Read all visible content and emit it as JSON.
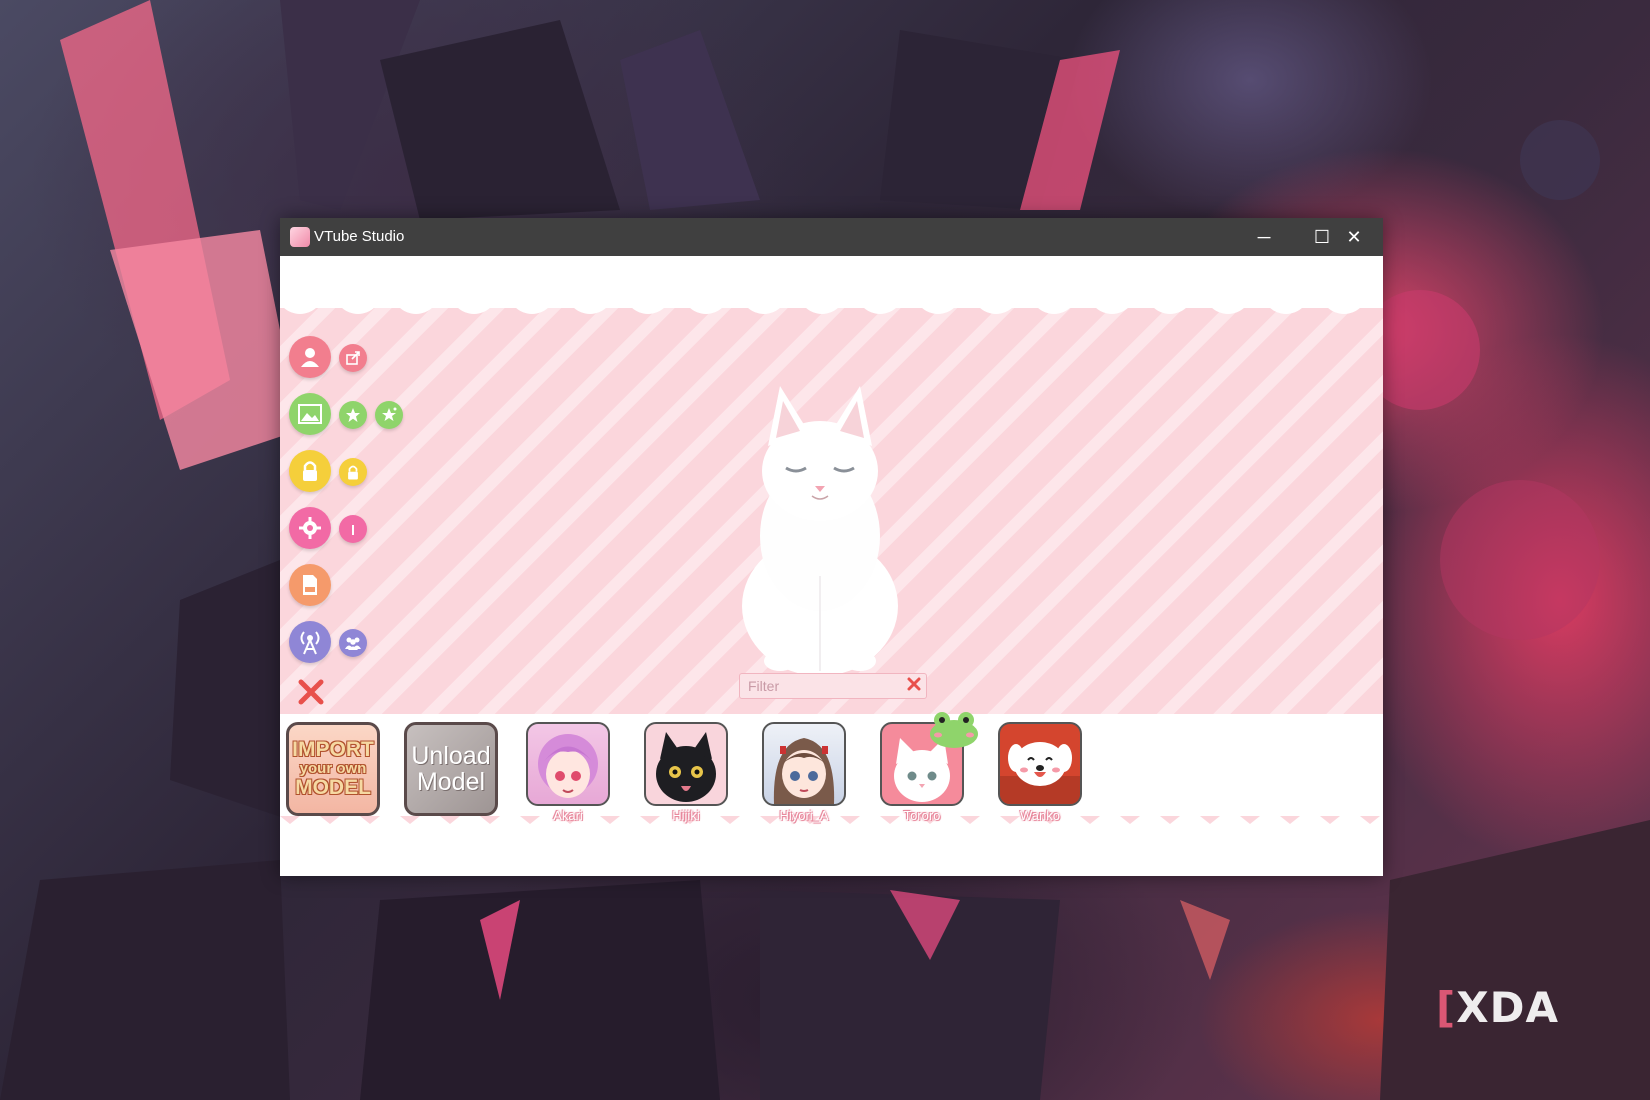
{
  "window": {
    "title": "VTube Studio",
    "controls": {
      "minimize": "─",
      "maximize": "☐",
      "close": "✕"
    }
  },
  "sidebar": {
    "rows": [
      {
        "main_icon": "person-icon",
        "extras": [
          "share-icon"
        ]
      },
      {
        "main_icon": "image-icon",
        "extras": [
          "star-icon",
          "sparkle-star-icon"
        ]
      },
      {
        "main_icon": "lock-icon",
        "extras": [
          "small-lock-icon"
        ]
      },
      {
        "main_icon": "gear-icon",
        "extras": [
          "info-icon"
        ]
      },
      {
        "main_icon": "document-icon",
        "extras": []
      },
      {
        "main_icon": "broadcast-icon",
        "extras": [
          "people-icon"
        ]
      },
      {
        "main_icon": "close-x-icon",
        "extras": []
      }
    ],
    "colors": {
      "pink": "#f27e8e",
      "green": "#8fd46b",
      "yellow": "#f5cf3b",
      "magenta": "#f26aa5",
      "orange": "#f59a6b",
      "purple": "#8f86d6",
      "red": "#e8504b"
    }
  },
  "filter": {
    "placeholder": "Filter",
    "value": "",
    "clear_icon": "close-x-icon"
  },
  "shelf": {
    "import_button": {
      "line1": "IMPORT",
      "line2": "your own",
      "line3": "MODEL"
    },
    "unload_button": {
      "line1": "Unload",
      "line2": "Model"
    },
    "models": [
      {
        "name": "Akari"
      },
      {
        "name": "Hijiki"
      },
      {
        "name": "Hiyori_A"
      },
      {
        "name": "Tororo"
      },
      {
        "name": "Wanko"
      }
    ]
  },
  "watermark": {
    "bracket": "[",
    "text": "XDA"
  }
}
